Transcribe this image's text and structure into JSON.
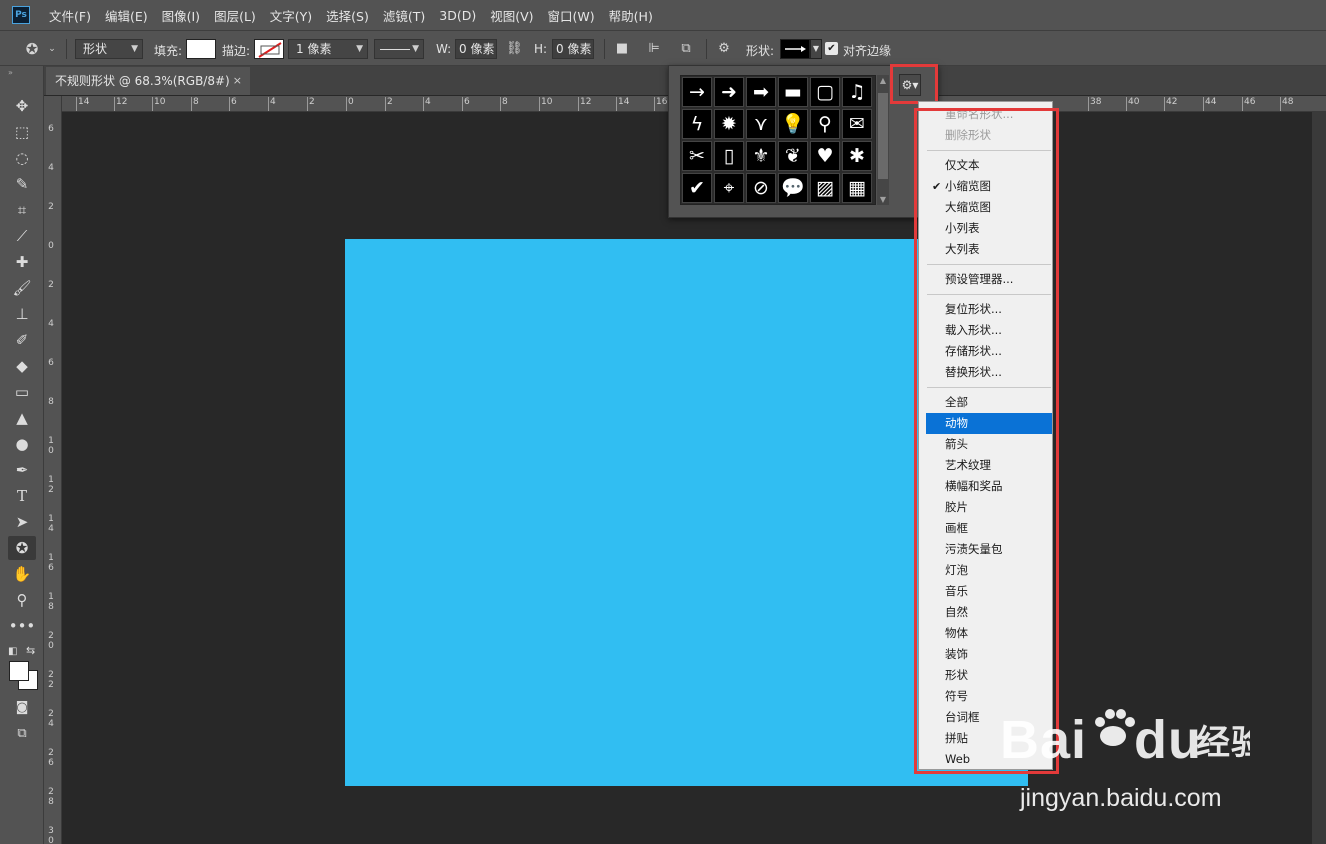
{
  "menubar": {
    "logo": "Ps",
    "items": [
      "文件(F)",
      "编辑(E)",
      "图像(I)",
      "图层(L)",
      "文字(Y)",
      "选择(S)",
      "滤镜(T)",
      "3D(D)",
      "视图(V)",
      "窗口(W)",
      "帮助(H)"
    ]
  },
  "options": {
    "mode_value": "形状",
    "fill_label": "填充:",
    "stroke_label": "描边:",
    "stroke_width_value": "1 像素",
    "w_label": "W:",
    "w_value": "0 像素",
    "h_label": "H:",
    "h_value": "0 像素",
    "shape_label": "形状:",
    "align_edges_label": "对齐边缘",
    "align_edges_checked": true
  },
  "document": {
    "tab_title": "不规则形状 @ 68.3%(RGB/8#)",
    "close": "×",
    "canvas_color": "#31bef2"
  },
  "rulers": {
    "top": [
      "14",
      "12",
      "10",
      "8",
      "6",
      "4",
      "2",
      "0",
      "2",
      "4",
      "6",
      "8",
      "10",
      "12",
      "14",
      "16",
      "38",
      "40",
      "42",
      "44",
      "46",
      "48"
    ],
    "left": [
      "6",
      "4",
      "2",
      "0",
      "2",
      "4",
      "6",
      "8",
      "1 0",
      "1 2",
      "1 4",
      "1 6",
      "1 8",
      "2 0",
      "2 2",
      "2 4",
      "2 6",
      "2 8",
      "3 0"
    ]
  },
  "picker": {
    "shapes": [
      "arrow-thin-icon",
      "arrow-bold-icon",
      "arrow-block-icon",
      "banner-icon",
      "frame-icon",
      "music-note-icon",
      "lightning-icon",
      "starburst-icon",
      "grass-icon",
      "lightbulb-icon",
      "pushpin-icon",
      "envelope-icon",
      "scissors-icon",
      "stamp-frame-icon",
      "fleur-de-lis-icon",
      "bird-icon",
      "heart-icon",
      "splat-icon",
      "checkmark-icon",
      "target-icon",
      "no-sign-icon",
      "speech-bubble-icon",
      "hatch-pattern-icon",
      "checker-pattern-icon"
    ]
  },
  "dropdown": {
    "group1": [
      "重命名形状...",
      "删除形状"
    ],
    "group2": [
      "仅文本",
      "小缩览图",
      "大缩览图",
      "小列表",
      "大列表"
    ],
    "checked": "小缩览图",
    "group3": [
      "预设管理器..."
    ],
    "group4": [
      "复位形状...",
      "载入形状...",
      "存储形状...",
      "替换形状..."
    ],
    "group5": [
      "全部",
      "动物",
      "箭头",
      "艺术纹理",
      "横幅和奖品",
      "胶片",
      "画框",
      "污渍矢量包",
      "灯泡",
      "音乐",
      "自然",
      "物体",
      "装饰",
      "形状",
      "符号",
      "台词框",
      "拼贴",
      "Web"
    ],
    "highlighted": "动物"
  },
  "watermark": {
    "logo": "Bai du 经验",
    "sub": "jingyan.baidu.com"
  }
}
